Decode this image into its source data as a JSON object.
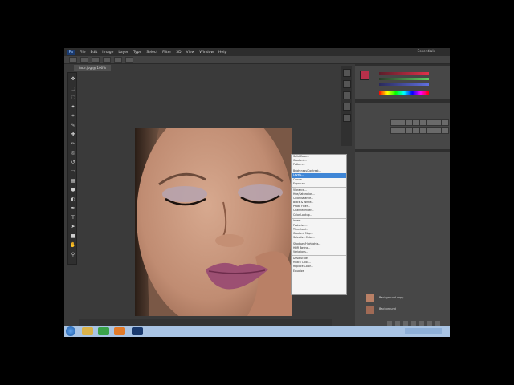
{
  "colors": {
    "workspace": "#3a3a3a",
    "panel": "#474747",
    "highlight": "#3f86d6",
    "taskbar": "#a9c4e4"
  },
  "menubar": {
    "logo": "Ps",
    "items": [
      "File",
      "Edit",
      "Image",
      "Layer",
      "Type",
      "Select",
      "Filter",
      "3D",
      "View",
      "Window",
      "Help"
    ],
    "workspace_label": "Essentials"
  },
  "document_tab": "face.jpg @ 100%",
  "tools": [
    "move-icon",
    "marquee-icon",
    "lasso-icon",
    "quick-select-icon",
    "crop-icon",
    "eyedropper-icon",
    "healing-icon",
    "brush-icon",
    "clone-icon",
    "history-brush-icon",
    "eraser-icon",
    "gradient-icon",
    "blur-icon",
    "dodge-icon",
    "pen-icon",
    "type-icon",
    "path-select-icon",
    "shape-icon",
    "hand-icon",
    "zoom-icon"
  ],
  "tool_glyphs": [
    "✥",
    "⬚",
    "◌",
    "✦",
    "⌗",
    "✎",
    "✚",
    "✏",
    "◎",
    "↺",
    "▭",
    "▦",
    "●",
    "◐",
    "✒",
    "T",
    "➤",
    "■",
    "✋",
    "⚲"
  ],
  "adjustment_menu": {
    "items": [
      {
        "label": "Solid Color...",
        "sep_after": false
      },
      {
        "label": "Gradient...",
        "sep_after": false
      },
      {
        "label": "Pattern...",
        "sep_after": true
      },
      {
        "label": "Brightness/Contrast...",
        "sep_after": false
      },
      {
        "label": "Levels...",
        "sep_after": false,
        "selected": true
      },
      {
        "label": "Curves...",
        "sep_after": false
      },
      {
        "label": "Exposure...",
        "sep_after": true
      },
      {
        "label": "Vibrance...",
        "sep_after": false
      },
      {
        "label": "Hue/Saturation...",
        "sep_after": false
      },
      {
        "label": "Color Balance...",
        "sep_after": false
      },
      {
        "label": "Black & White...",
        "sep_after": false
      },
      {
        "label": "Photo Filter...",
        "sep_after": false
      },
      {
        "label": "Channel Mixer...",
        "sep_after": false
      },
      {
        "label": "Color Lookup...",
        "sep_after": true
      },
      {
        "label": "Invert",
        "sep_after": false
      },
      {
        "label": "Posterize...",
        "sep_after": false
      },
      {
        "label": "Threshold...",
        "sep_after": false
      },
      {
        "label": "Gradient Map...",
        "sep_after": false
      },
      {
        "label": "Selective Color...",
        "sep_after": true
      },
      {
        "label": "Shadows/Highlights...",
        "sep_after": false
      },
      {
        "label": "HDR Toning...",
        "sep_after": false
      },
      {
        "label": "Variations...",
        "sep_after": true
      },
      {
        "label": "Desaturate",
        "sep_after": false
      },
      {
        "label": "Match Color...",
        "sep_after": false
      },
      {
        "label": "Replace Color...",
        "sep_after": false
      },
      {
        "label": "Equalize",
        "sep_after": false
      }
    ]
  },
  "layers": [
    {
      "name": "Background copy"
    },
    {
      "name": "Background"
    }
  ],
  "taskbar": {
    "apps": [
      "explorer-icon",
      "chrome-icon",
      "media-icon",
      "photoshop-icon"
    ]
  }
}
